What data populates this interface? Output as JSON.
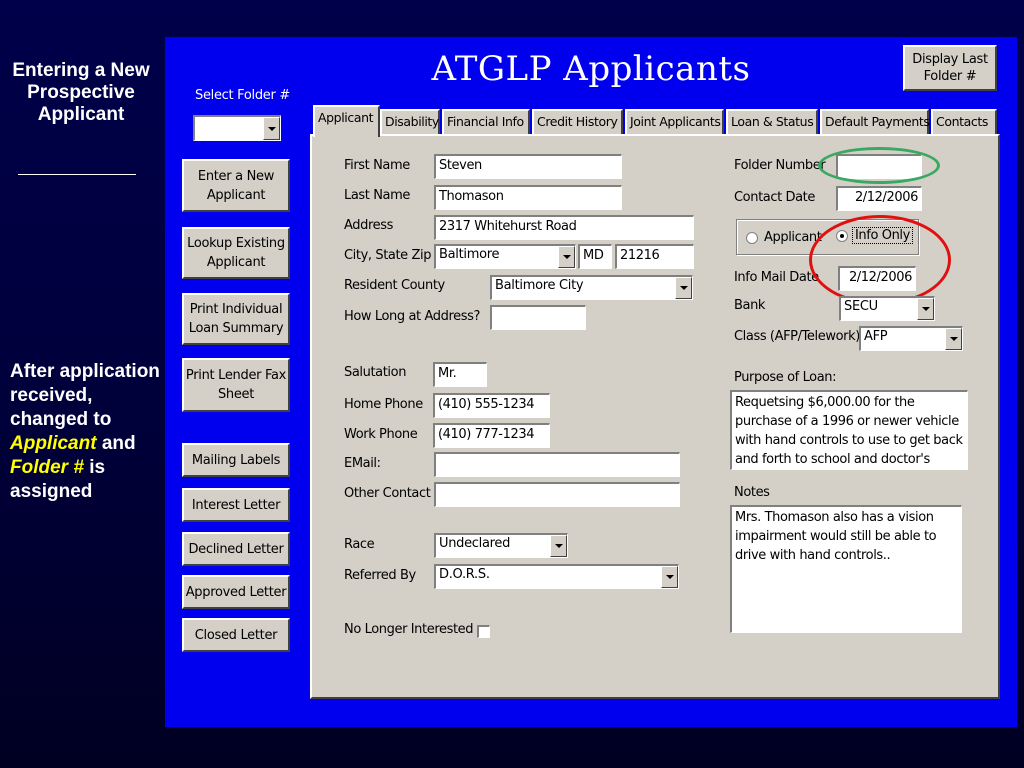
{
  "slide": {
    "title": "Entering a New Prospective Applicant",
    "note_prefix": "After application received, changed to",
    "note_applicant": "Applicant",
    "note_and": "and",
    "note_folder": "Folder  #",
    "note_suffix": "is assigned"
  },
  "app": {
    "title": "ATGLP Applicants",
    "display_last_folder_label": "Display Last Folder #",
    "select_folder_label": "Select Folder #",
    "select_folder_value": "",
    "sidebar_buttons": [
      {
        "label": "Enter a New Applicant"
      },
      {
        "label": "Lookup Existing Applicant"
      },
      {
        "label": "Print Individual Loan Summary"
      },
      {
        "label": "Print Lender Fax Sheet"
      },
      {
        "label": "Mailing Labels"
      },
      {
        "label": "Interest Letter"
      },
      {
        "label": "Declined Letter"
      },
      {
        "label": "Approved Letter"
      },
      {
        "label": "Closed Letter"
      }
    ],
    "tabs": [
      "Applicant",
      "Disability",
      "Financial Info",
      "Credit History",
      "Joint Applicants",
      "Loan & Status",
      "Default Payments",
      "Contacts"
    ],
    "active_tab": "Applicant"
  },
  "form": {
    "first_name_label": "First Name",
    "first_name": "Steven",
    "last_name_label": "Last Name",
    "last_name": "Thomason",
    "address_label": "Address",
    "address": "2317 Whitehurst Road",
    "city_state_zip_label": "City, State Zip",
    "city": "Baltimore",
    "state": "MD",
    "zip": "21216",
    "county_label": "Resident County",
    "county": "Baltimore City",
    "how_long_label": "How Long at Address?",
    "how_long": "",
    "salutation_label": "Salutation",
    "salutation": "Mr.",
    "home_phone_label": "Home Phone",
    "home_phone": "(410) 555-1234",
    "work_phone_label": "Work Phone",
    "work_phone": "(410) 777-1234",
    "email_label": "EMail:",
    "email": "",
    "other_contact_label": "Other Contact",
    "other_contact": "",
    "race_label": "Race",
    "race": "Undeclared",
    "referred_by_label": "Referred By",
    "referred_by": "D.O.R.S.",
    "no_longer_label": "No Longer Interested",
    "folder_number_label": "Folder Number",
    "folder_number": "",
    "contact_date_label": "Contact Date",
    "contact_date": "2/12/2006",
    "radio_applicant_label": "Applicant",
    "radio_info_only_label": "Info Only",
    "info_mail_date_label": "Info Mail Date",
    "info_mail_date": "2/12/2006",
    "bank_label": "Bank",
    "bank": "SECU",
    "class_label": "Class (AFP/Telework)",
    "class": "AFP",
    "purpose_label": "Purpose of Loan:",
    "purpose": "Requetsing $6,000.00 for the purchase of a 1996 or newer vehicle with hand controls to use to get back and forth to school and doctor's",
    "notes_label": "Notes",
    "notes": "Mrs. Thomason also has a vision impairment would still be able to drive with hand controls.."
  },
  "colors": {
    "slide_background": "#00004a",
    "window_blue": "#0000ee",
    "dialog_gray": "#d4d0c8",
    "highlight_green": "#3aa860",
    "highlight_red": "#e01010",
    "note_emphasis": "#ffff00"
  }
}
